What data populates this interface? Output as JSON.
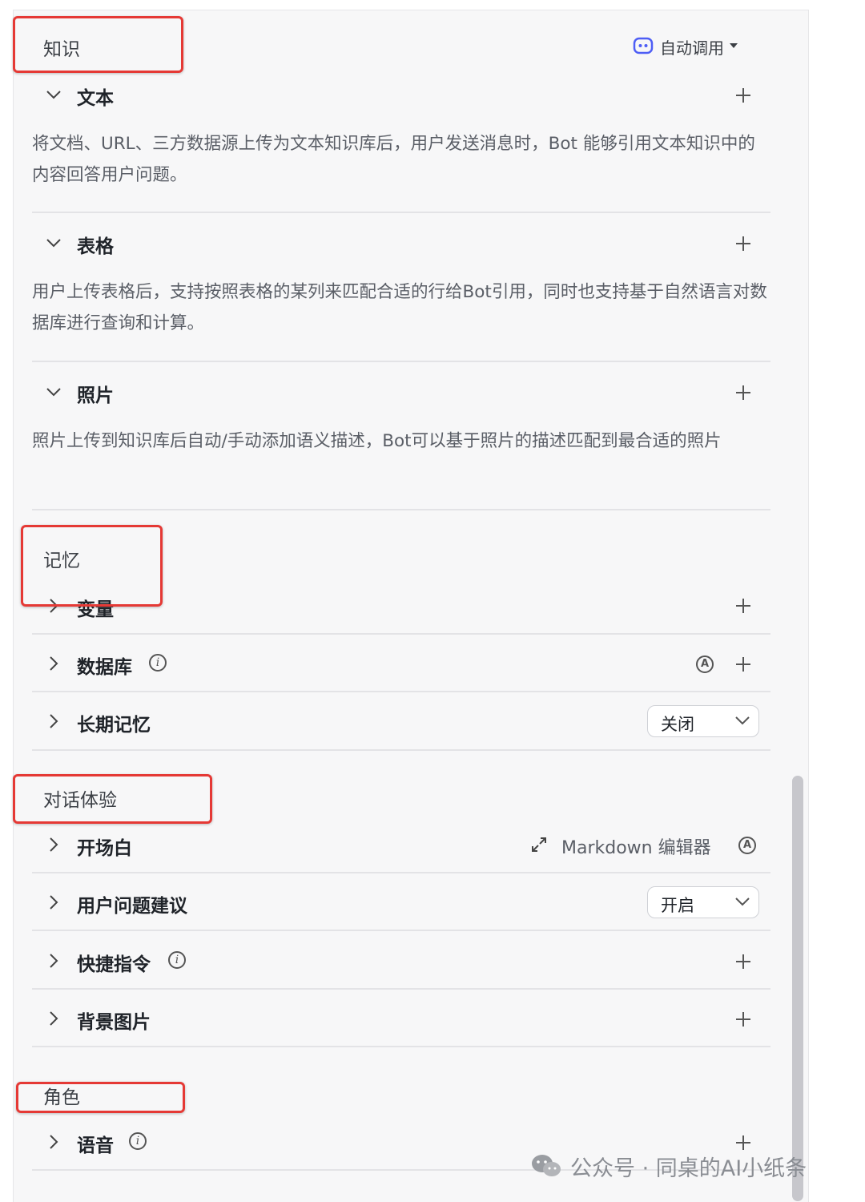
{
  "sections": {
    "knowledge": {
      "title": "知识",
      "auto_call": "自动调用",
      "items": [
        {
          "title": "文本",
          "desc": "将文档、URL、三方数据源上传为文本知识库后，用户发送消息时，Bot 能够引用文本知识中的内容回答用户问题。"
        },
        {
          "title": "表格",
          "desc": "用户上传表格后，支持按照表格的某列来匹配合适的行给Bot引用，同时也支持基于自然语言对数据库进行查询和计算。"
        },
        {
          "title": "照片",
          "desc": "照片上传到知识库后自动/手动添加语义描述，Bot可以基于照片的描述匹配到最合适的照片"
        }
      ]
    },
    "memory": {
      "title": "记忆",
      "items": [
        {
          "title": "变量"
        },
        {
          "title": "数据库"
        },
        {
          "title": "长期记忆",
          "select_value": "关闭"
        }
      ]
    },
    "dialog": {
      "title": "对话体验",
      "items": [
        {
          "title": "开场白",
          "extra": "Markdown 编辑器"
        },
        {
          "title": "用户问题建议",
          "select_value": "开启"
        },
        {
          "title": "快捷指令"
        },
        {
          "title": "背景图片"
        }
      ]
    },
    "role": {
      "title": "角色",
      "items": [
        {
          "title": "语音"
        }
      ]
    }
  },
  "watermark": "公众号 · 同桌的AI小纸条",
  "colors": {
    "highlight_box": "#e53935",
    "accent": "#4e5ef5"
  }
}
